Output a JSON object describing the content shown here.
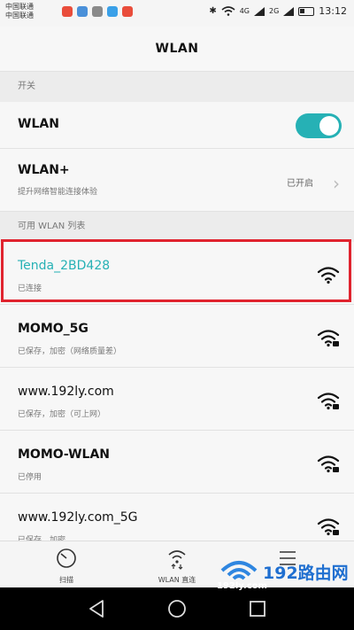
{
  "status_bar": {
    "carrier_1": "中国联通",
    "carrier_2": "中国联通",
    "network_1": "4G",
    "network_2": "2G",
    "time": "13:12"
  },
  "header": {
    "title": "WLAN"
  },
  "sections": {
    "switch_header": "开关",
    "available_header": "可用 WLAN 列表"
  },
  "wlan_toggle": {
    "label": "WLAN",
    "on": true
  },
  "wlan_plus": {
    "label": "WLAN+",
    "sub": "提升网络智能连接体验",
    "status": "已开启"
  },
  "networks": [
    {
      "ssid": "Tenda_2BD428",
      "status": "已连接",
      "color": "#26b1b5",
      "locked": false
    },
    {
      "ssid": "MOMO_5G",
      "status": "已保存，加密（网络质量差）",
      "locked": true
    },
    {
      "ssid": "www.192ly.com",
      "status": "已保存，加密（可上网）",
      "locked": true
    },
    {
      "ssid": "MOMO-WLAN",
      "status": "已停用",
      "locked": true
    },
    {
      "ssid": "www.192ly.com_5G",
      "status": "已保存，加密",
      "locked": true
    }
  ],
  "bottom_tabs": [
    {
      "label": "扫描",
      "icon": "scan-icon"
    },
    {
      "label": "WLAN 直连",
      "icon": "wifi-direct-icon"
    },
    {
      "label": "",
      "icon": "menu-icon"
    }
  ],
  "watermark": {
    "text": "192路由网",
    "url": "192ly.com"
  },
  "colors": {
    "accent": "#26b1b5",
    "highlight": "#e0232e"
  }
}
